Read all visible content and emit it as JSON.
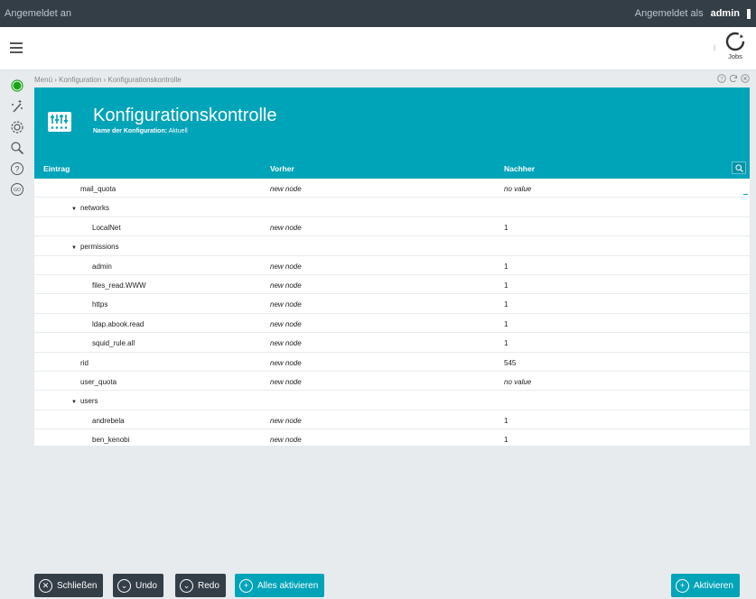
{
  "topbar": {
    "left_text": "Angemeldet an",
    "logged_in_label": "Angemeldet als",
    "user": "admin"
  },
  "header": {
    "jobs_label": "Jobs",
    "tick": "|"
  },
  "icons": [
    "status-dot-icon",
    "wizard-icon",
    "gear-icon",
    "search-icon",
    "help-icon",
    "go-icon"
  ],
  "breadcrumb": "Menü › Konfiguration › Konfigurationskontrolle",
  "panel": {
    "title": "Konfigurationskontrolle",
    "subtitle_label": "Name der Konfiguration:",
    "subtitle_value": "Aktuell",
    "columns": [
      "Eintrag",
      "Vorher",
      "Nachher"
    ]
  },
  "rows": [
    {
      "entry": "mail_quota",
      "before": "new node",
      "after": "no value",
      "level": 1,
      "group": false,
      "after_italic": true
    },
    {
      "entry": "networks",
      "before": "",
      "after": "",
      "level": 1,
      "group": true,
      "after_italic": false
    },
    {
      "entry": "LocalNet",
      "before": "new node",
      "after": "1",
      "level": 2,
      "group": false,
      "after_italic": false
    },
    {
      "entry": "permissions",
      "before": "",
      "after": "",
      "level": 1,
      "group": true,
      "after_italic": false
    },
    {
      "entry": "admin",
      "before": "new node",
      "after": "1",
      "level": 2,
      "group": false,
      "after_italic": false
    },
    {
      "entry": "files_read.WWW",
      "before": "new node",
      "after": "1",
      "level": 2,
      "group": false,
      "after_italic": false
    },
    {
      "entry": "https",
      "before": "new node",
      "after": "1",
      "level": 2,
      "group": false,
      "after_italic": false
    },
    {
      "entry": "ldap.abook.read",
      "before": "new node",
      "after": "1",
      "level": 2,
      "group": false,
      "after_italic": false
    },
    {
      "entry": "squid_rule.all",
      "before": "new node",
      "after": "1",
      "level": 2,
      "group": false,
      "after_italic": false
    },
    {
      "entry": "rid",
      "before": "new node",
      "after": "545",
      "level": 1,
      "group": false,
      "after_italic": false
    },
    {
      "entry": "user_quota",
      "before": "new node",
      "after": "no value",
      "level": 1,
      "group": false,
      "after_italic": true
    },
    {
      "entry": "users",
      "before": "",
      "after": "",
      "level": 1,
      "group": true,
      "after_italic": false
    },
    {
      "entry": "andrebela",
      "before": "new node",
      "after": "1",
      "level": 2,
      "group": false,
      "after_italic": false
    },
    {
      "entry": "ben_kenobi",
      "before": "new node",
      "after": "1",
      "level": 2,
      "group": false,
      "after_italic": false
    }
  ],
  "buttons": {
    "close": "Schließen",
    "undo": "Undo",
    "redo": "Redo",
    "activate_all": "Alles aktivieren",
    "activate": "Aktivieren"
  },
  "colors": {
    "accent": "#00a4b8",
    "dark": "#343e47",
    "status_green": "#1aa31a"
  }
}
